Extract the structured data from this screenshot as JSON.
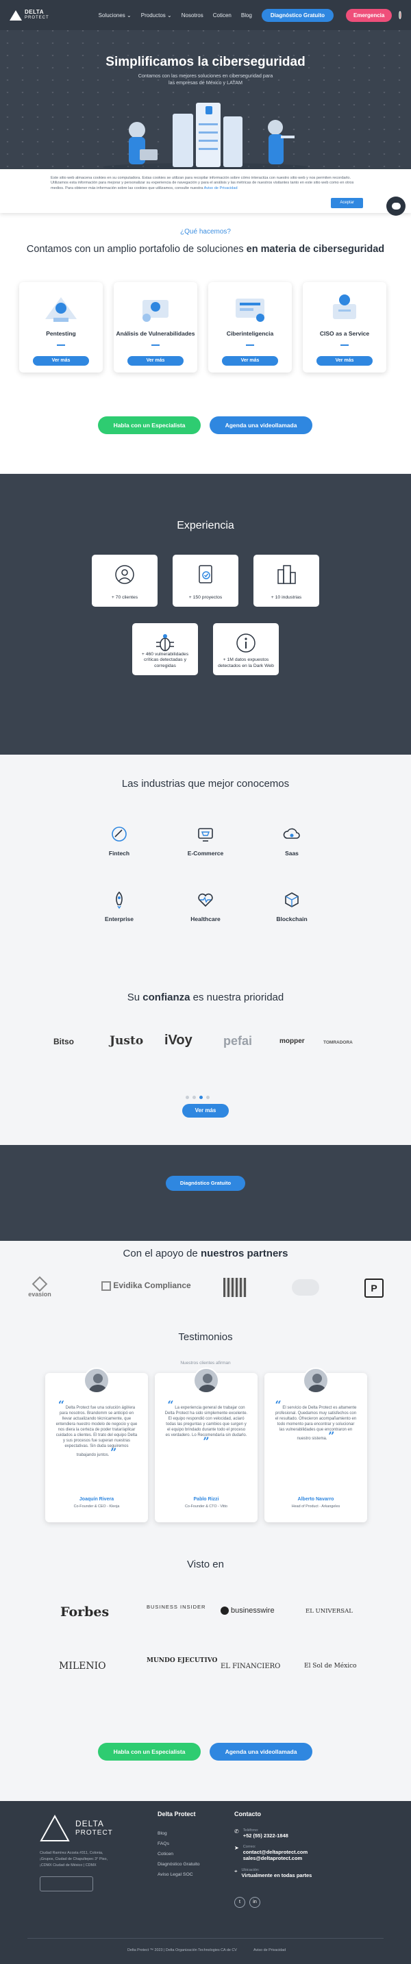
{
  "nav": {
    "logo": "DELTA",
    "logo_sub": "PROTECT",
    "items": [
      "Soluciones",
      "Productos",
      "Nosotros",
      "Coticen",
      "Blog"
    ],
    "diag_btn": "Diagnóstico Gratuito",
    "emergency_btn": "Emergencia"
  },
  "hero": {
    "title": "Simplificamos la ciberseguridad",
    "subtitle": "Contamos con las mejores soluciones en ciberseguridad para las empresas de México y LATAM"
  },
  "cookie": {
    "text": "Este sitio web almacena cookies en su computadora. Estas cookies se utilizan para recopilar información sobre cómo interactúa con nuestro sitio web y nos permiten recordarlo. Utilizamos esta información para mejorar y personalizar su experiencia de navegación y para el análisis y las métricas de nuestros visitantes tanto en este sitio web como en otros medios. Para obtener más información sobre las cookies que utilizamos, consulte nuestra",
    "link": "Aviso de Privacidad",
    "accept": "Aceptar"
  },
  "services": {
    "question": "¿Qué hacemos?",
    "title_pre": "Contamos con un amplio portafolio de soluciones",
    "title_bold": "en materia de ciberseguridad",
    "cards": [
      {
        "title": "Pentesting",
        "cta": "Ver más"
      },
      {
        "title": "Análisis de Vulnerabilidades",
        "cta": "Ver más"
      },
      {
        "title": "Ciberinteligencia",
        "cta": "Ver más"
      },
      {
        "title": "CISO as a Service",
        "cta": "Ver más"
      }
    ],
    "cta_specialist": "Habla con un Especialista",
    "cta_video": "Agenda una videollamada"
  },
  "experience": {
    "title": "Experiencia",
    "stats": [
      {
        "text": "+ 70 clientes",
        "icon": "user-icon"
      },
      {
        "text": "+ 150 proyectos",
        "icon": "document-check-icon"
      },
      {
        "text": "+ 10 industrias",
        "icon": "buildings-icon"
      },
      {
        "text": "+ 460 vulnerabilidades críticas detectadas y corregidas",
        "icon": "bug-icon"
      },
      {
        "text": "+ 1M datos expuestos detectados en la Dark Web",
        "icon": "info-icon"
      }
    ]
  },
  "industries": {
    "title": "Las industrias que mejor conocemos",
    "items": [
      "Fintech",
      "E-Commerce",
      "Saas",
      "Enterprise",
      "Healthcare",
      "Blockchain"
    ]
  },
  "trust": {
    "title_pre": "Su",
    "title_bold": "confianza",
    "title_post": "es nuestra prioridad",
    "logos": [
      "Bitso",
      "Justo",
      "iVoy",
      "pefai",
      "mopper",
      "TOMRADORA"
    ],
    "cta": "Ver más"
  },
  "diag_band": {
    "cta": "Diagnóstico Gratuito"
  },
  "partners": {
    "title_pre": "Con el apoyo de",
    "title_bold": "nuestros partners",
    "logos": [
      "evasion",
      "Evidika Compliance"
    ]
  },
  "testimonials": {
    "title": "Testimonios",
    "subtitle": "Nuestros clientes afirman",
    "items": [
      {
        "quote": "Delta Protect fue una solución ágil/era para nosotros. Brandomm se anticipó en llevar actualizando técnicamente, que entendiera nuestro modelo de negocio y que nos diera la certeza de poder tratar/aplicar cuidados a clientes. El trato del equipo Delta y sus procesos fue superan nuestras expectativas. Sin duda seguiremos trabajando juntos.",
        "name": "Joaquín Rivera",
        "role": "Co-Founder & CEO - Kleoja"
      },
      {
        "quote": "La experiencia general de trabajar con Delta Protect ha sido simplemente excelente. El equipo respondió con velocidad, aclaró todas las preguntas y cambios que surgen y el equipo brindado durante todo el proceso es verdadero. Lo Recomendaría sin dudarlo.",
        "name": "Pablo Rizzi",
        "role": "Co-Founder & CTO - Vitto"
      },
      {
        "quote": "El servicio de Delta Protect es altamente profesional. Quedamos muy satisfechos con el resultado. Ofrecieron acompañamiento en todo momento para encontrar y solucionar las vulnerabilidades que encontraron en nuestro sistema.",
        "name": "Alberto Navarro",
        "role": "Head of Product - Arkangeles"
      }
    ]
  },
  "press": {
    "title": "Visto en",
    "logos": [
      "Forbes",
      "BUSINESS INSIDER",
      "businesswire",
      "EL UNIVERSAL",
      "MILENIO",
      "MUNDO EJECUTIVO",
      "EL FINANCIERO",
      "El Sol de México"
    ]
  },
  "footer": {
    "address": "Ciudad Ramírez Acosta #311, Colonia, ¡Grupos, Ciudad de Chapultepec 3° Piso, ¡CDMX Ciudad de México | CDMX",
    "col1_title": "Delta Protect",
    "links": [
      "Blog",
      "FAQs",
      "Coticen",
      "Diagnóstico Gratuito",
      "Aviso Legal SOC"
    ],
    "col2_title": "Contacto",
    "phone_label": "Teléfono:",
    "phone": "+52 (55) 2322-1848",
    "email_label": "Correo:",
    "email1": "contact@deltaprotect.com",
    "email2": "sales@deltaprotect.com",
    "address_label": "Ubicación:",
    "address_val": "Virtualmente en todas partes",
    "copyright": "Delta Protect ™ 2023 | Delta Organización Technologies CA de CV",
    "privacy": "Aviso de Privacidad"
  }
}
